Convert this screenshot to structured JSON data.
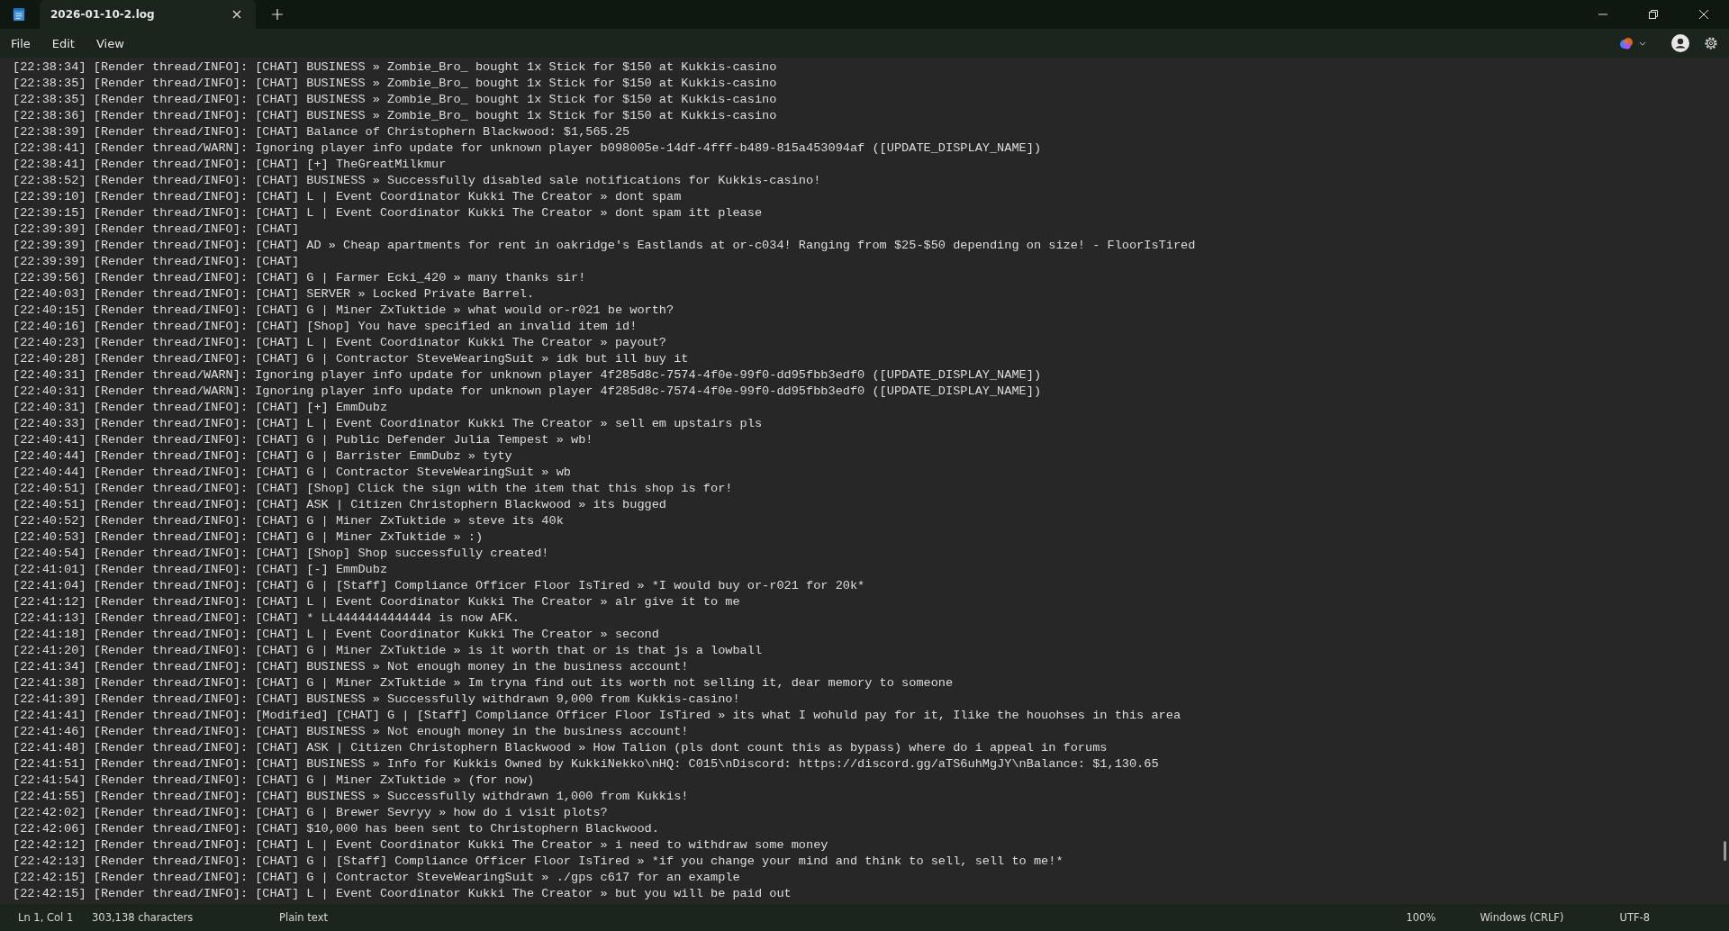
{
  "tab": {
    "title": "2026-01-10-2.log",
    "selected": true
  },
  "menu": [
    "File",
    "Edit",
    "View"
  ],
  "lines": [
    "[22:38:34] [Render thread/INFO]: [CHAT] BUSINESS » Zombie_Bro_ bought 1x Stick for $150 at Kukkis-casino",
    "[22:38:35] [Render thread/INFO]: [CHAT] BUSINESS » Zombie_Bro_ bought 1x Stick for $150 at Kukkis-casino",
    "[22:38:35] [Render thread/INFO]: [CHAT] BUSINESS » Zombie_Bro_ bought 1x Stick for $150 at Kukkis-casino",
    "[22:38:36] [Render thread/INFO]: [CHAT] BUSINESS » Zombie_Bro_ bought 1x Stick for $150 at Kukkis-casino",
    "[22:38:39] [Render thread/INFO]: [CHAT] Balance of Christophern Blackwood: $1,565.25",
    "[22:38:41] [Render thread/WARN]: Ignoring player info update for unknown player b098005e-14df-4fff-b489-815a453094af ([UPDATE_DISPLAY_NAME])",
    "[22:38:41] [Render thread/INFO]: [CHAT] [+] TheGreatMilkmur",
    "[22:38:52] [Render thread/INFO]: [CHAT] BUSINESS » Successfully disabled sale notifications for Kukkis-casino!",
    "[22:39:10] [Render thread/INFO]: [CHAT] L | Event Coordinator Kukki The Creator » dont spam",
    "[22:39:15] [Render thread/INFO]: [CHAT] L | Event Coordinator Kukki The Creator » dont spam itt please",
    "[22:39:39] [Render thread/INFO]: [CHAT]",
    "[22:39:39] [Render thread/INFO]: [CHAT] AD » Cheap apartments for rent in oakridge's Eastlands at or-c034! Ranging from $25-$50 depending on size! - FloorIsTired",
    "[22:39:39] [Render thread/INFO]: [CHAT]",
    "[22:39:56] [Render thread/INFO]: [CHAT] G | Farmer Ecki_420 » many thanks sir!",
    "[22:40:03] [Render thread/INFO]: [CHAT] SERVER » Locked Private Barrel.",
    "[22:40:15] [Render thread/INFO]: [CHAT] G | Miner ZxTuktide » what would or-r021 be worth?",
    "[22:40:16] [Render thread/INFO]: [CHAT] [Shop] You have specified an invalid item id!",
    "[22:40:23] [Render thread/INFO]: [CHAT] L | Event Coordinator Kukki The Creator » payout?",
    "[22:40:28] [Render thread/INFO]: [CHAT] G | Contractor SteveWearingSuit » idk but ill buy it",
    "[22:40:31] [Render thread/WARN]: Ignoring player info update for unknown player 4f285d8c-7574-4f0e-99f0-dd95fbb3edf0 ([UPDATE_DISPLAY_NAME])",
    "[22:40:31] [Render thread/WARN]: Ignoring player info update for unknown player 4f285d8c-7574-4f0e-99f0-dd95fbb3edf0 ([UPDATE_DISPLAY_NAME])",
    "[22:40:31] [Render thread/INFO]: [CHAT] [+] EmmDubz",
    "[22:40:33] [Render thread/INFO]: [CHAT] L | Event Coordinator Kukki The Creator » sell em upstairs pls",
    "[22:40:41] [Render thread/INFO]: [CHAT] G | Public Defender Julia Tempest » wb!",
    "[22:40:44] [Render thread/INFO]: [CHAT] G | Barrister EmmDubz » tyty",
    "[22:40:44] [Render thread/INFO]: [CHAT] G | Contractor SteveWearingSuit » wb",
    "[22:40:51] [Render thread/INFO]: [CHAT] [Shop] Click the sign with the item that this shop is for!",
    "[22:40:51] [Render thread/INFO]: [CHAT] ASK | Citizen Christophern Blackwood » its bugged",
    "[22:40:52] [Render thread/INFO]: [CHAT] G | Miner ZxTuktide » steve its 40k",
    "[22:40:53] [Render thread/INFO]: [CHAT] G | Miner ZxTuktide » :)",
    "[22:40:54] [Render thread/INFO]: [CHAT] [Shop] Shop successfully created!",
    "[22:41:01] [Render thread/INFO]: [CHAT] [-] EmmDubz",
    "[22:41:04] [Render thread/INFO]: [CHAT] G | [Staff] Compliance Officer Floor IsTired » *I would buy or-r021 for 20k*",
    "[22:41:12] [Render thread/INFO]: [CHAT] L | Event Coordinator Kukki The Creator » alr give it to me",
    "[22:41:13] [Render thread/INFO]: [CHAT] * LL4444444444444 is now AFK.",
    "[22:41:18] [Render thread/INFO]: [CHAT] L | Event Coordinator Kukki The Creator » second",
    "[22:41:20] [Render thread/INFO]: [CHAT] G | Miner ZxTuktide » is it worth that or is that js a lowball",
    "[22:41:34] [Render thread/INFO]: [CHAT] BUSINESS » Not enough money in the business account!",
    "[22:41:38] [Render thread/INFO]: [CHAT] G | Miner ZxTuktide » Im tryna find out its worth not selling it, dear memory to someone",
    "[22:41:39] [Render thread/INFO]: [CHAT] BUSINESS » Successfully withdrawn 9,000 from Kukkis-casino!",
    "[22:41:41] [Render thread/INFO]: [Modified] [CHAT] G | [Staff] Compliance Officer Floor IsTired » its what I wohuld pay for it, Ilike the houohses in this area",
    "[22:41:46] [Render thread/INFO]: [CHAT] BUSINESS » Not enough money in the business account!",
    "[22:41:48] [Render thread/INFO]: [CHAT] ASK | Citizen Christophern Blackwood » How Talion (pls dont count this as bypass) where do i appeal in forums",
    "[22:41:51] [Render thread/INFO]: [CHAT] BUSINESS » Info for Kukkis Owned by KukkiNekko\\nHQ: C015\\nDiscord: https://discord.gg/aTS6uhMgJY\\nBalance: $1,130.65",
    "[22:41:54] [Render thread/INFO]: [CHAT] G | Miner ZxTuktide » (for now)",
    "[22:41:55] [Render thread/INFO]: [CHAT] BUSINESS » Successfully withdrawn 1,000 from Kukkis!",
    "[22:42:02] [Render thread/INFO]: [CHAT] G | Brewer Sevryy » how do i visit plots?",
    "[22:42:06] [Render thread/INFO]: [CHAT] $10,000 has been sent to Christophern Blackwood.",
    "[22:42:12] [Render thread/INFO]: [CHAT] L | Event Coordinator Kukki The Creator » i need to withdraw some money",
    "[22:42:13] [Render thread/INFO]: [CHAT] G | [Staff] Compliance Officer Floor IsTired » *if you change your mind and think to sell, sell to me!*",
    "[22:42:15] [Render thread/INFO]: [CHAT] G | Contractor SteveWearingSuit » ./gps c617 for an example",
    "[22:42:15] [Render thread/INFO]: [CHAT] L | Event Coordinator Kukki The Creator » but you will be paid out"
  ],
  "status_bar": {
    "position": "Ln 1, Col 1",
    "characters": "303,138 characters",
    "format": "Plain text",
    "zoom": "100%",
    "line_ending": "Windows (CRLF)",
    "encoding": "UTF-8"
  }
}
